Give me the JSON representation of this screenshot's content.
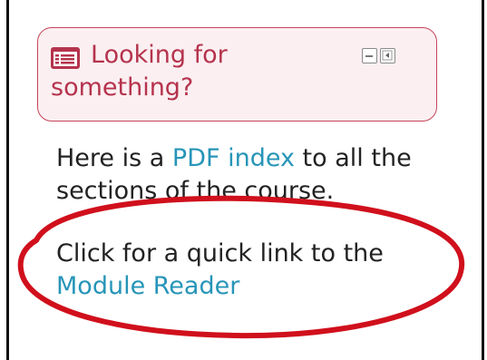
{
  "block": {
    "title": "Looking for something?",
    "icon": "list-card-icon",
    "controls": [
      {
        "name": "collapse-block",
        "icon": "minus-box-icon"
      },
      {
        "name": "dock-block",
        "icon": "dock-left-icon"
      }
    ],
    "accent_color": "#b5334d",
    "header_bg": "#fbeff1"
  },
  "content": {
    "line1_prefix": "Here is a ",
    "pdf_link": "PDF index",
    "line1_suffix": " to all the sections of the course.",
    "line2_prefix": "Click for a quick link to the ",
    "module_link": "Module Reader"
  },
  "annotation": {
    "shape": "ellipse",
    "color": "#d0101c"
  }
}
